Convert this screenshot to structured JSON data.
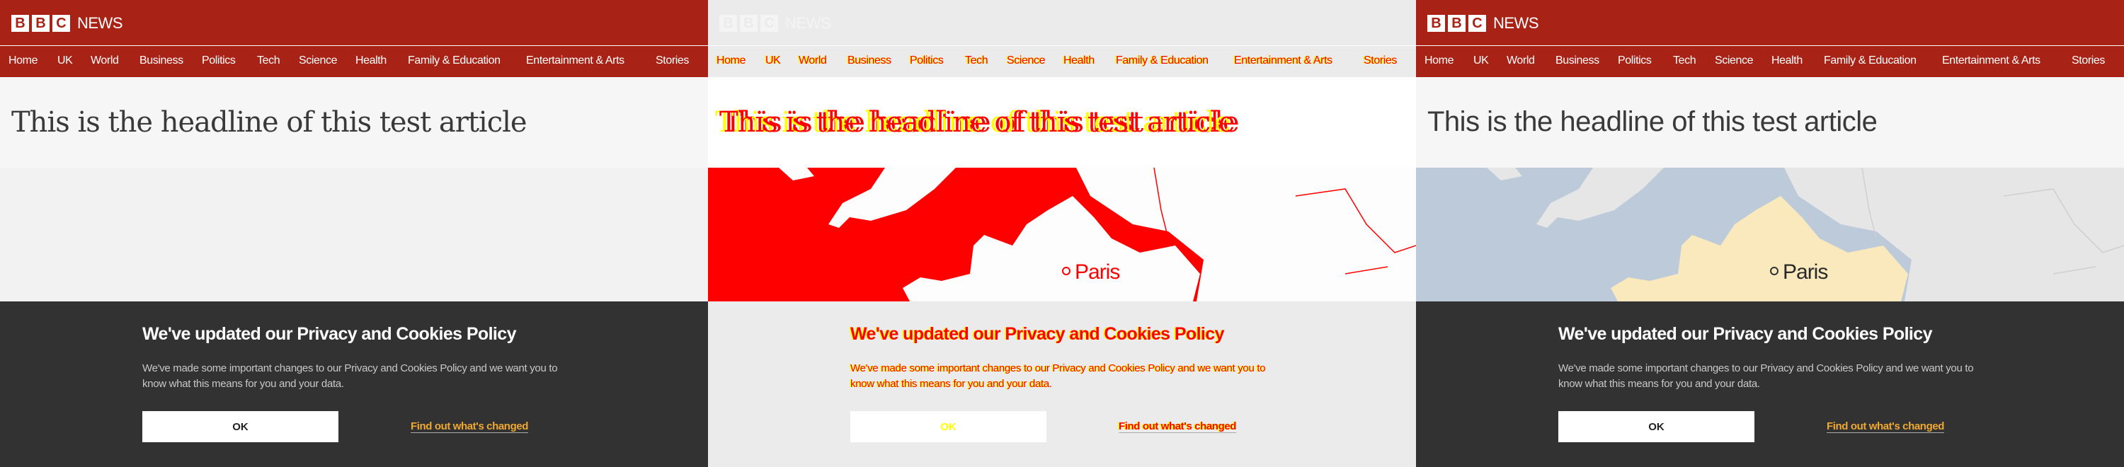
{
  "header": {
    "logo_letters": [
      "B",
      "B",
      "C"
    ],
    "logo_word": "NEWS",
    "brand_color": "#a82216"
  },
  "nav": {
    "items": [
      "Home",
      "UK",
      "World",
      "Business",
      "Politics",
      "Tech",
      "Science",
      "Health",
      "Family & Education",
      "Entertainment & Arts",
      "Stories"
    ]
  },
  "article": {
    "headline": "This is the headline of this test article",
    "map_label": "Paris"
  },
  "cookie_banner": {
    "title": "We've updated our Privacy and Cookies Policy",
    "body": "We've made some important changes to our Privacy and Cookies Policy and we want you to know what this means for you and your data.",
    "ok_label": "OK",
    "link_label": "Find out what's changed",
    "link_color": "#f0a830",
    "background": "#323232"
  },
  "diff_colors": {
    "changed": "#ff0000",
    "shifted": "#ffff00"
  }
}
